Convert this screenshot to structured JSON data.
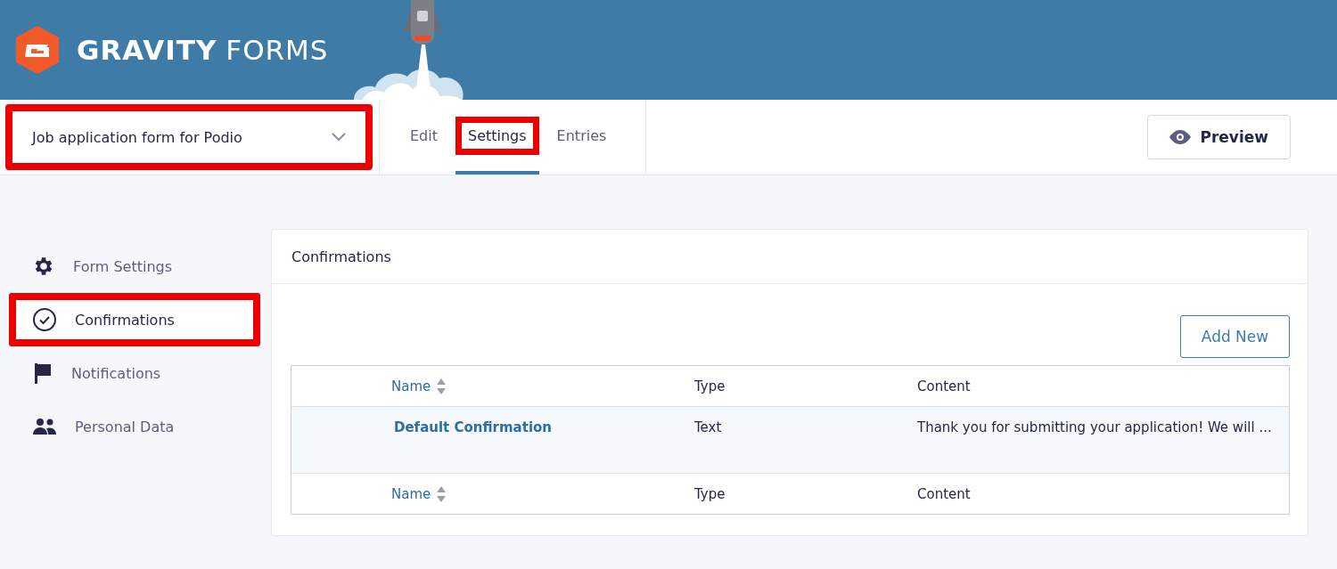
{
  "brand": {
    "name_bold": "GRAVITY",
    "name_light": "FORMS"
  },
  "form_selector": {
    "value": "Job application form for Podio",
    "highlighted": true
  },
  "tabs": [
    {
      "label": "Edit",
      "selected": false,
      "highlighted": false
    },
    {
      "label": "Settings",
      "selected": true,
      "highlighted": true
    },
    {
      "label": "Entries",
      "selected": false,
      "highlighted": false
    }
  ],
  "preview_button": "Preview",
  "sidebar": {
    "items": [
      {
        "label": "Form Settings",
        "kind": "gear",
        "selected": false,
        "highlighted": false
      },
      {
        "label": "Confirmations",
        "kind": "check",
        "selected": true,
        "highlighted": true
      },
      {
        "label": "Notifications",
        "kind": "flag",
        "selected": false,
        "highlighted": false
      },
      {
        "label": "Personal Data",
        "kind": "people",
        "selected": false,
        "highlighted": false
      }
    ]
  },
  "panel": {
    "title": "Confirmations",
    "add_button": "Add New",
    "table": {
      "columns": [
        "Name",
        "Type",
        "Content"
      ],
      "rows": [
        {
          "name": "Default Confirmation",
          "type": "Text",
          "content": "Thank you for submitting your application! We will ..."
        }
      ],
      "footer": [
        "Name",
        "Type",
        "Content"
      ]
    }
  }
}
